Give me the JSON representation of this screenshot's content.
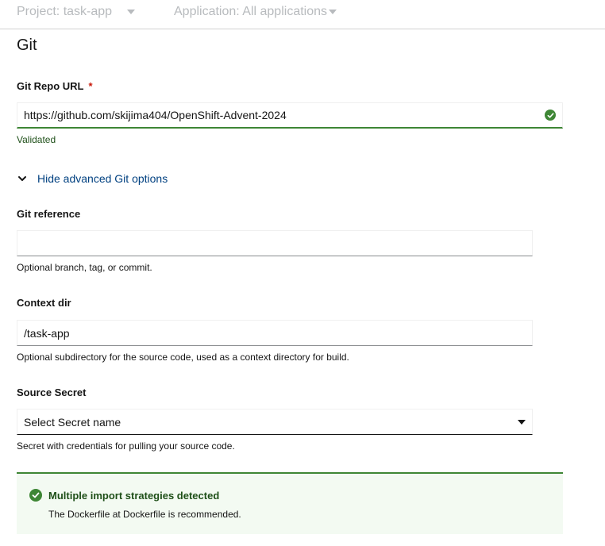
{
  "topbar": {
    "project": "Project: task-app",
    "application": "Application: All applications"
  },
  "section": {
    "title": "Git"
  },
  "git_url": {
    "label": "Git Repo URL",
    "required_mark": "*",
    "value": "https://github.com/skijima404/OpenShift-Advent-2024",
    "status": "Validated",
    "status_color": "#3e8635"
  },
  "advanced_toggle": {
    "label": "Hide advanced Git options"
  },
  "git_reference": {
    "label": "Git reference",
    "value": "",
    "helper": "Optional branch, tag, or commit."
  },
  "context_dir": {
    "label": "Context dir",
    "value": "/task-app",
    "helper": "Optional subdirectory for the source code, used as a context directory for build."
  },
  "source_secret": {
    "label": "Source Secret",
    "selected": "Select Secret name",
    "helper": "Secret with credentials for pulling your source code."
  },
  "alert": {
    "title": "Multiple import strategies detected",
    "body": "The Dockerfile at Dockerfile is recommended.",
    "color": "#3e8635"
  }
}
